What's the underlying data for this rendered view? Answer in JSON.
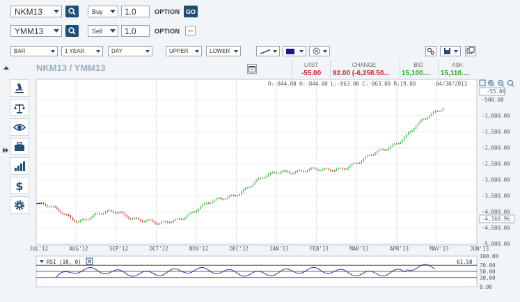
{
  "toolbar": {
    "row1": {
      "symbol": "NKM13",
      "side": "Buy",
      "qty": "1.0",
      "option_label": "OPTION",
      "go_label": "GO"
    },
    "row2": {
      "symbol": "YMM13",
      "side": "Sell",
      "qty": "1.0",
      "option_label": "OPTION"
    },
    "controls": {
      "chart_type": "BAR",
      "range": "1 YEAR",
      "interval": "DAY",
      "upper": "UPPER",
      "lower": "LOWER"
    }
  },
  "chart_header": {
    "title": "NKM13 / YMM13",
    "last_label": "LAST",
    "last_value": "-55.00",
    "change_label": "CHANGE",
    "change_value": "92.00 (-6,258.50...",
    "bid_label": "BID",
    "bid_value": "15,100....",
    "ask_label": "ASK",
    "ask_value": "15,110....",
    "ohlc": "O:-844.00 H:-844.00 L:-863.00 C:-863.00 R:19.00",
    "date": "04/30/2013"
  },
  "price_axis": {
    "labels": [
      "-500.00",
      "-1,000.00",
      "-1,500.00",
      "-2,000.00",
      "-2,500.00",
      "-3,000.00",
      "-3,500.00",
      "-4,000.00",
      "-4,500.00",
      "-5,000.00"
    ],
    "current_label": "-55.00",
    "cursor_label": "-4,160.96"
  },
  "time_axis": {
    "labels": [
      "JUL'12",
      "AUG'12",
      "SEP'12",
      "OCT'12",
      "NOV'12",
      "DEC'12",
      "JAN'13",
      "FEB'13",
      "MAR'13",
      "APR'13",
      "MAY'13",
      "JUN'13"
    ]
  },
  "rsi": {
    "label": "RSI (10, 0)",
    "value": "61.58",
    "axis": [
      "100.00",
      "70.00",
      "50.00",
      "30.00",
      "0.00"
    ]
  },
  "colors": {
    "up": "#22aa22",
    "down": "#cc2222",
    "rsi_line": "#1a1aa0",
    "accent": "#1f4e79"
  },
  "sidebar_icons": [
    "microscope-icon",
    "scales-icon",
    "eye-icon",
    "briefcase-icon",
    "bar-chart-icon",
    "dollar-icon",
    "gear-icon"
  ],
  "chart_data": {
    "type": "bar",
    "x": [
      "JUL'12",
      "AUG'12",
      "SEP'12",
      "OCT'12",
      "NOV'12",
      "DEC'12",
      "JAN'13",
      "FEB'13",
      "MAR'13",
      "APR'13",
      "MAY'13"
    ],
    "values": [
      -3750,
      -4250,
      -4000,
      -4450,
      -3900,
      -3350,
      -2700,
      -2750,
      -2450,
      -1700,
      -700
    ],
    "ylim": [
      -5000,
      0
    ]
  }
}
